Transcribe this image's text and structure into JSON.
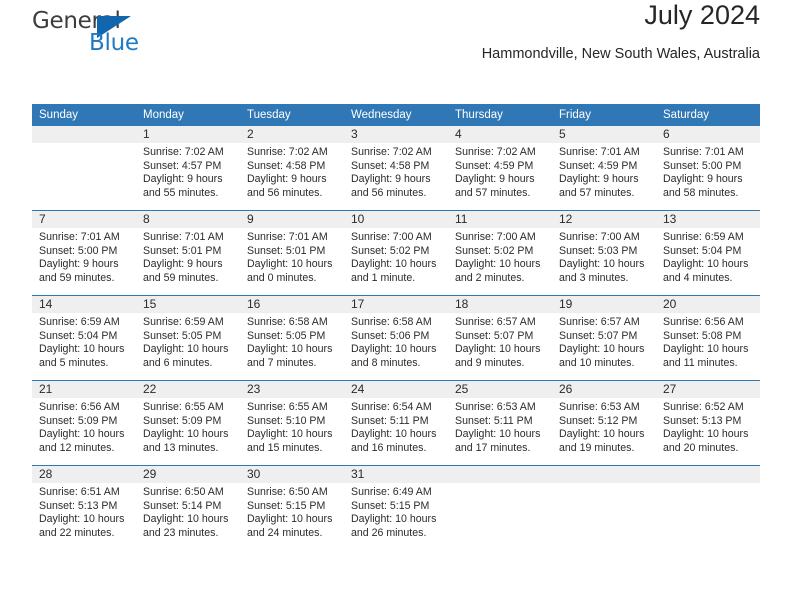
{
  "brand": {
    "name_top": "General",
    "name_bottom": "Blue",
    "accent_color": "#1f7ac4",
    "triangle_color": "#1266ae",
    "logo_icon": "general-blue-logo"
  },
  "header": {
    "title": "July 2024",
    "subtitle": "Hammondville, New South Wales, Australia"
  },
  "theme": {
    "header_bg": "#3077b6",
    "daynum_band_bg": "#efefef",
    "row_divider": "#3077b6",
    "text": "#2b2b2b"
  },
  "calendar": {
    "weekday_headers": [
      "Sunday",
      "Monday",
      "Tuesday",
      "Wednesday",
      "Thursday",
      "Friday",
      "Saturday"
    ],
    "weeks": [
      [
        {
          "day": "",
          "sunrise": "",
          "sunset": "",
          "daylight_line1": "",
          "daylight_line2": ""
        },
        {
          "day": "1",
          "sunrise": "Sunrise: 7:02 AM",
          "sunset": "Sunset: 4:57 PM",
          "daylight_line1": "Daylight: 9 hours",
          "daylight_line2": "and 55 minutes."
        },
        {
          "day": "2",
          "sunrise": "Sunrise: 7:02 AM",
          "sunset": "Sunset: 4:58 PM",
          "daylight_line1": "Daylight: 9 hours",
          "daylight_line2": "and 56 minutes."
        },
        {
          "day": "3",
          "sunrise": "Sunrise: 7:02 AM",
          "sunset": "Sunset: 4:58 PM",
          "daylight_line1": "Daylight: 9 hours",
          "daylight_line2": "and 56 minutes."
        },
        {
          "day": "4",
          "sunrise": "Sunrise: 7:02 AM",
          "sunset": "Sunset: 4:59 PM",
          "daylight_line1": "Daylight: 9 hours",
          "daylight_line2": "and 57 minutes."
        },
        {
          "day": "5",
          "sunrise": "Sunrise: 7:01 AM",
          "sunset": "Sunset: 4:59 PM",
          "daylight_line1": "Daylight: 9 hours",
          "daylight_line2": "and 57 minutes."
        },
        {
          "day": "6",
          "sunrise": "Sunrise: 7:01 AM",
          "sunset": "Sunset: 5:00 PM",
          "daylight_line1": "Daylight: 9 hours",
          "daylight_line2": "and 58 minutes."
        }
      ],
      [
        {
          "day": "7",
          "sunrise": "Sunrise: 7:01 AM",
          "sunset": "Sunset: 5:00 PM",
          "daylight_line1": "Daylight: 9 hours",
          "daylight_line2": "and 59 minutes."
        },
        {
          "day": "8",
          "sunrise": "Sunrise: 7:01 AM",
          "sunset": "Sunset: 5:01 PM",
          "daylight_line1": "Daylight: 9 hours",
          "daylight_line2": "and 59 minutes."
        },
        {
          "day": "9",
          "sunrise": "Sunrise: 7:01 AM",
          "sunset": "Sunset: 5:01 PM",
          "daylight_line1": "Daylight: 10 hours",
          "daylight_line2": "and 0 minutes."
        },
        {
          "day": "10",
          "sunrise": "Sunrise: 7:00 AM",
          "sunset": "Sunset: 5:02 PM",
          "daylight_line1": "Daylight: 10 hours",
          "daylight_line2": "and 1 minute."
        },
        {
          "day": "11",
          "sunrise": "Sunrise: 7:00 AM",
          "sunset": "Sunset: 5:02 PM",
          "daylight_line1": "Daylight: 10 hours",
          "daylight_line2": "and 2 minutes."
        },
        {
          "day": "12",
          "sunrise": "Sunrise: 7:00 AM",
          "sunset": "Sunset: 5:03 PM",
          "daylight_line1": "Daylight: 10 hours",
          "daylight_line2": "and 3 minutes."
        },
        {
          "day": "13",
          "sunrise": "Sunrise: 6:59 AM",
          "sunset": "Sunset: 5:04 PM",
          "daylight_line1": "Daylight: 10 hours",
          "daylight_line2": "and 4 minutes."
        }
      ],
      [
        {
          "day": "14",
          "sunrise": "Sunrise: 6:59 AM",
          "sunset": "Sunset: 5:04 PM",
          "daylight_line1": "Daylight: 10 hours",
          "daylight_line2": "and 5 minutes."
        },
        {
          "day": "15",
          "sunrise": "Sunrise: 6:59 AM",
          "sunset": "Sunset: 5:05 PM",
          "daylight_line1": "Daylight: 10 hours",
          "daylight_line2": "and 6 minutes."
        },
        {
          "day": "16",
          "sunrise": "Sunrise: 6:58 AM",
          "sunset": "Sunset: 5:05 PM",
          "daylight_line1": "Daylight: 10 hours",
          "daylight_line2": "and 7 minutes."
        },
        {
          "day": "17",
          "sunrise": "Sunrise: 6:58 AM",
          "sunset": "Sunset: 5:06 PM",
          "daylight_line1": "Daylight: 10 hours",
          "daylight_line2": "and 8 minutes."
        },
        {
          "day": "18",
          "sunrise": "Sunrise: 6:57 AM",
          "sunset": "Sunset: 5:07 PM",
          "daylight_line1": "Daylight: 10 hours",
          "daylight_line2": "and 9 minutes."
        },
        {
          "day": "19",
          "sunrise": "Sunrise: 6:57 AM",
          "sunset": "Sunset: 5:07 PM",
          "daylight_line1": "Daylight: 10 hours",
          "daylight_line2": "and 10 minutes."
        },
        {
          "day": "20",
          "sunrise": "Sunrise: 6:56 AM",
          "sunset": "Sunset: 5:08 PM",
          "daylight_line1": "Daylight: 10 hours",
          "daylight_line2": "and 11 minutes."
        }
      ],
      [
        {
          "day": "21",
          "sunrise": "Sunrise: 6:56 AM",
          "sunset": "Sunset: 5:09 PM",
          "daylight_line1": "Daylight: 10 hours",
          "daylight_line2": "and 12 minutes."
        },
        {
          "day": "22",
          "sunrise": "Sunrise: 6:55 AM",
          "sunset": "Sunset: 5:09 PM",
          "daylight_line1": "Daylight: 10 hours",
          "daylight_line2": "and 13 minutes."
        },
        {
          "day": "23",
          "sunrise": "Sunrise: 6:55 AM",
          "sunset": "Sunset: 5:10 PM",
          "daylight_line1": "Daylight: 10 hours",
          "daylight_line2": "and 15 minutes."
        },
        {
          "day": "24",
          "sunrise": "Sunrise: 6:54 AM",
          "sunset": "Sunset: 5:11 PM",
          "daylight_line1": "Daylight: 10 hours",
          "daylight_line2": "and 16 minutes."
        },
        {
          "day": "25",
          "sunrise": "Sunrise: 6:53 AM",
          "sunset": "Sunset: 5:11 PM",
          "daylight_line1": "Daylight: 10 hours",
          "daylight_line2": "and 17 minutes."
        },
        {
          "day": "26",
          "sunrise": "Sunrise: 6:53 AM",
          "sunset": "Sunset: 5:12 PM",
          "daylight_line1": "Daylight: 10 hours",
          "daylight_line2": "and 19 minutes."
        },
        {
          "day": "27",
          "sunrise": "Sunrise: 6:52 AM",
          "sunset": "Sunset: 5:13 PM",
          "daylight_line1": "Daylight: 10 hours",
          "daylight_line2": "and 20 minutes."
        }
      ],
      [
        {
          "day": "28",
          "sunrise": "Sunrise: 6:51 AM",
          "sunset": "Sunset: 5:13 PM",
          "daylight_line1": "Daylight: 10 hours",
          "daylight_line2": "and 22 minutes."
        },
        {
          "day": "29",
          "sunrise": "Sunrise: 6:50 AM",
          "sunset": "Sunset: 5:14 PM",
          "daylight_line1": "Daylight: 10 hours",
          "daylight_line2": "and 23 minutes."
        },
        {
          "day": "30",
          "sunrise": "Sunrise: 6:50 AM",
          "sunset": "Sunset: 5:15 PM",
          "daylight_line1": "Daylight: 10 hours",
          "daylight_line2": "and 24 minutes."
        },
        {
          "day": "31",
          "sunrise": "Sunrise: 6:49 AM",
          "sunset": "Sunset: 5:15 PM",
          "daylight_line1": "Daylight: 10 hours",
          "daylight_line2": "and 26 minutes."
        },
        {
          "day": "",
          "sunrise": "",
          "sunset": "",
          "daylight_line1": "",
          "daylight_line2": ""
        },
        {
          "day": "",
          "sunrise": "",
          "sunset": "",
          "daylight_line1": "",
          "daylight_line2": ""
        },
        {
          "day": "",
          "sunrise": "",
          "sunset": "",
          "daylight_line1": "",
          "daylight_line2": ""
        }
      ]
    ]
  }
}
